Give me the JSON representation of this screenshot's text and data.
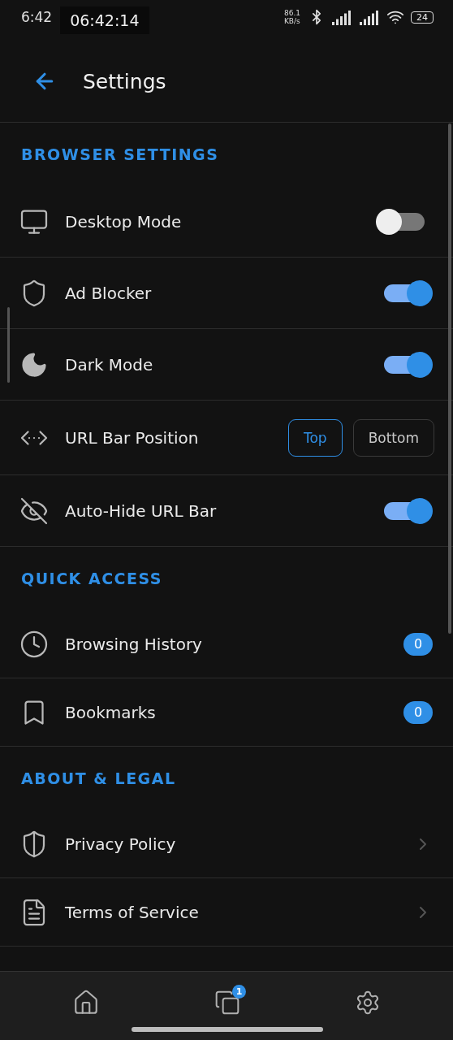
{
  "status_bar": {
    "time": "6:42",
    "clock": "06:42:14",
    "speed_value": "86.1",
    "speed_unit": "KB/s",
    "battery": "24"
  },
  "header": {
    "title": "Settings"
  },
  "sections": [
    {
      "heading": "BROWSER SETTINGS",
      "rows": [
        {
          "kind": "toggle",
          "label": "Desktop Mode",
          "on": false
        },
        {
          "kind": "toggle",
          "label": "Ad Blocker",
          "on": true
        },
        {
          "kind": "toggle",
          "label": "Dark Mode",
          "on": true
        },
        {
          "kind": "choice",
          "label": "URL Bar Position",
          "options": [
            {
              "label": "Top",
              "selected": true
            },
            {
              "label": "Bottom",
              "selected": false
            }
          ]
        },
        {
          "kind": "toggle",
          "label": "Auto-Hide URL Bar",
          "on": true
        }
      ]
    },
    {
      "heading": "QUICK ACCESS",
      "rows": [
        {
          "kind": "count",
          "label": "Browsing History",
          "count": "0"
        },
        {
          "kind": "count",
          "label": "Bookmarks",
          "count": "0"
        }
      ]
    },
    {
      "heading": "ABOUT & LEGAL",
      "rows": [
        {
          "kind": "link",
          "label": "Privacy Policy"
        },
        {
          "kind": "link",
          "label": "Terms of Service"
        }
      ]
    }
  ],
  "bottom_nav": {
    "tabs_count": "1"
  }
}
